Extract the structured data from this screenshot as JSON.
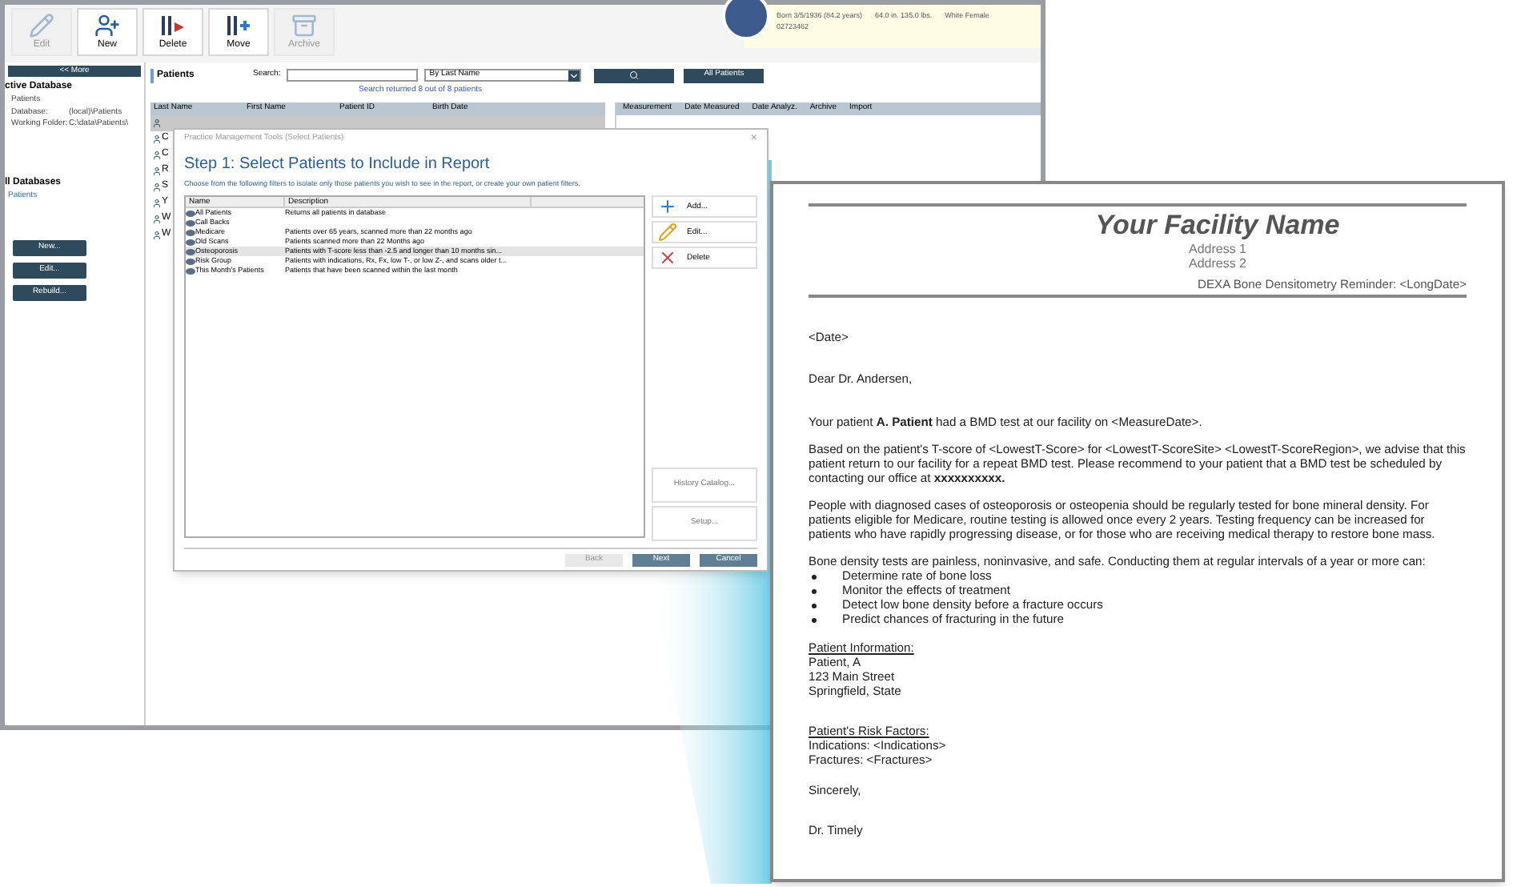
{
  "toolbar": [
    {
      "label": "Edit",
      "disabled": true
    },
    {
      "label": "New",
      "disabled": false
    },
    {
      "label": "Delete",
      "disabled": false
    },
    {
      "label": "Move",
      "disabled": false
    },
    {
      "label": "Archive",
      "disabled": true
    }
  ],
  "patient_header": {
    "info": [
      "Born 3/5/1936 (84.2 years)",
      "64.0 in. 135.0 lbs.",
      "White Female"
    ],
    "id": "02723462"
  },
  "sidebar": {
    "more": "<< More",
    "active_title": "ctive Database",
    "active_label": "Patients",
    "fields": [
      {
        "label": "Database:",
        "value": "(local)\\Patients"
      },
      {
        "label": "Working Folder:",
        "value": "C:\\data\\Patients\\"
      }
    ],
    "all_title": "ll Databases",
    "databases": [
      {
        "label": "Patients",
        "selected": true
      }
    ],
    "buttons": [
      "New...",
      "Edit...",
      "Rebuild..."
    ]
  },
  "patients": {
    "title": "Patients",
    "search_label": "Search:",
    "search_by": "By Last Name",
    "all_button": "All Patients",
    "result": "Search returned 8 out of 8 patients",
    "columns": [
      "Last Name",
      "First Name",
      "Patient ID",
      "Birth Date"
    ],
    "rows": [
      {
        "cell": "",
        "selected": true
      },
      {
        "cell": "C",
        "selected": false
      },
      {
        "cell": "C",
        "selected": false
      },
      {
        "cell": "R",
        "selected": false
      },
      {
        "cell": "S",
        "selected": false
      },
      {
        "cell": "Y",
        "selected": false
      },
      {
        "cell": "W",
        "selected": false
      },
      {
        "cell": "W",
        "selected": false
      }
    ]
  },
  "measurements": {
    "columns": [
      "Measurement",
      "Date Measured",
      "Date Analyz.",
      "Archive",
      "Import"
    ]
  },
  "dialog": {
    "title": "Practice Management Tools (Select Patients)",
    "close": "×",
    "heading": "Step 1: Select Patients to Include in Report",
    "instruction": "Choose from the following filters to isolate only those patients you wish to see in the report, or create your own patient filters.",
    "columns": [
      "Name",
      "Description"
    ],
    "filters": [
      {
        "name": "All Patients",
        "description": "Returns all patients in database",
        "selected": false
      },
      {
        "name": "Call Backs",
        "selected": false
      },
      {
        "name": "Medicare",
        "description": "Patients over 65 years, scanned more than 22 months ago",
        "selected": false
      },
      {
        "name": "Old Scans",
        "description": "Patients scanned more than 22 Months ago",
        "selected": false
      },
      {
        "name": "Osteoporosis",
        "description": "Patients with T-score less than -2.5 and longer than 10 months sin...",
        "selected": true
      },
      {
        "name": "Risk Group",
        "description": "Patients with indications, Rx, Fx, low T-, or low Z-, and scans older t...",
        "selected": false
      },
      {
        "name": "This Month's Patients",
        "description": "Patients that have been scanned within the last month",
        "selected": false
      }
    ],
    "actions": [
      {
        "label": "Add..."
      },
      {
        "label": "Edit..."
      },
      {
        "label": "Delete"
      }
    ],
    "side_buttons": [
      "History Catalog...",
      "Setup..."
    ],
    "footer": [
      {
        "label": "Back",
        "disabled": true
      },
      {
        "label": "Next",
        "disabled": false
      },
      {
        "label": "Cancel",
        "disabled": false
      }
    ]
  },
  "letter": {
    "facility": "Your Facility Name",
    "address": [
      "Address 1",
      "Address 2"
    ],
    "subject": "DEXA Bone Densitometry Reminder:  <LongDate>",
    "date": "<Date>",
    "greeting": "Dear Dr. Andersen,",
    "paragraphs": [
      "Your patient **A. Patient** had a BMD test at our facility on <MeasureDate>.",
      "Based on the patient's T-score of <LowestT-Score> for <LowestT-ScoreSite> <LowestT-ScoreRegion>, we advise that this patient return to our facility for a repeat BMD test.  Please recommend to your patient that a BMD test be scheduled by contacting our office at **xxxxxxxxxx.**",
      "People with diagnosed cases of osteoporosis or osteopenia should be regularly tested for bone mineral density.  For patients eligible for Medicare, routine testing is allowed once every 2 years. Testing frequency can be increased for patients who have rapidly progressing disease, or for those who are receiving medical therapy to restore bone mass.",
      "Bone density tests are painless, noninvasive, and safe.  Conducting them at regular intervals of a year or more can:"
    ],
    "bullets": [
      "Determine rate of bone loss",
      "Monitor the effects of treatment",
      "Detect low bone density before a fracture occurs",
      "Predict chances of fracturing in the future"
    ],
    "blocks": [
      {
        "heading": "Patient Information:",
        "lines": [
          "Patient, A",
          "123 Main Street",
          "Springfield, State"
        ]
      },
      {
        "heading": "Patient's Risk Factors:",
        "lines": [
          "Indications: <Indications>",
          "Fractures: <Fractures>"
        ]
      }
    ],
    "closing": "Sincerely,",
    "signature": "Dr. Timely"
  }
}
